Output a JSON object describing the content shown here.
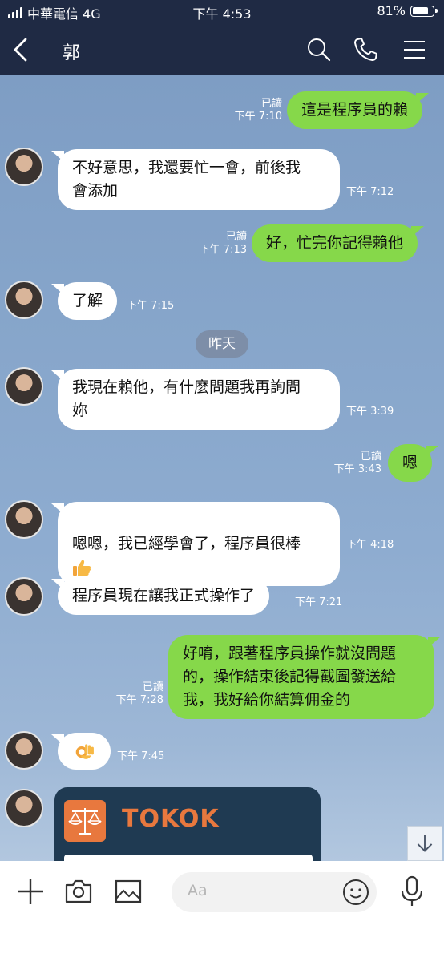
{
  "status_bar": {
    "carrier": "中華電信 4G",
    "time": "下午 4:53",
    "battery_percent": "81%",
    "battery_level": 0.81
  },
  "header": {
    "contact_name": "郭",
    "icons": [
      "back-arrow-icon",
      "search-icon",
      "phone-icon",
      "menu-icon"
    ]
  },
  "messages": [
    {
      "direction": "out",
      "text": "這是程序員的賴",
      "read": "已讀",
      "time": "下午 7:10"
    },
    {
      "direction": "in",
      "text": "不好意思，我還要忙一會，前後我\n會添加",
      "time": "下午 7:12"
    },
    {
      "direction": "out",
      "text": "好，忙完你記得賴他",
      "read": "已讀",
      "time": "下午 7:13"
    },
    {
      "direction": "in",
      "text": "了解",
      "time": "下午 7:15"
    },
    {
      "direction": "in",
      "text": "我現在賴他，有什麼問題我再詢問\n妳",
      "time": "下午 3:39"
    },
    {
      "direction": "out",
      "text": "嗯",
      "read": "已讀",
      "time": "下午 3:43"
    },
    {
      "direction": "in",
      "text": "嗯嗯，我已經學會了，程序員很棒",
      "emoji": "thumbs-up-emoji",
      "time": "下午 4:18"
    },
    {
      "direction": "in",
      "text": "程序員現在讓我正式操作了",
      "time": "下午 7:21"
    },
    {
      "direction": "out",
      "text": "好唷，跟著程序員操作就沒問題\n的，操作結束後記得截圖發送給\n我，我好給你結算佣金的",
      "read": "已讀",
      "time": "下午 7:28"
    },
    {
      "direction": "in",
      "emoji": "ok-hand-emoji",
      "time": "下午 7:45"
    }
  ],
  "date_divider": "昨天",
  "shared_card": {
    "brand": "TOKOK",
    "logo_icon": "scale-logo-icon"
  },
  "input_bar": {
    "placeholder": "Aa",
    "icons": [
      "plus-icon",
      "camera-icon",
      "image-icon",
      "emoji-icon",
      "microphone-icon"
    ]
  },
  "colors": {
    "header_bg": "#1f2a44",
    "outgoing_bubble": "#86d84a",
    "incoming_bubble": "#ffffff",
    "brand_orange": "#e8783e"
  }
}
